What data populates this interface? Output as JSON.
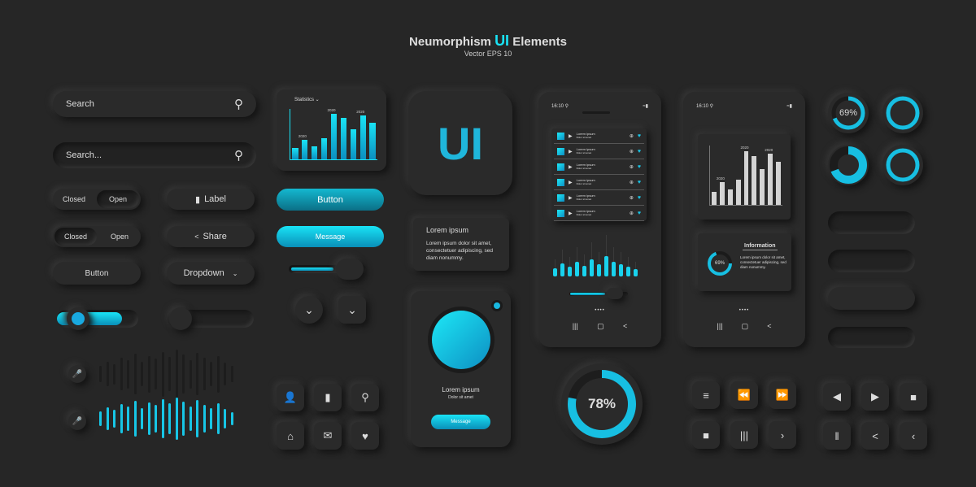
{
  "title": {
    "before": "Neumorphism ",
    "accent": "UI",
    "after": " Elements",
    "subtitle": "Vector EPS 10"
  },
  "colors": {
    "accent": "#19e3f5",
    "accent_dark": "#0a8fb8",
    "background": "#262626"
  },
  "search": [
    {
      "placeholder": "Search"
    },
    {
      "placeholder": "Search..."
    }
  ],
  "toggles": [
    {
      "off": "Closed",
      "on": "Open"
    },
    {
      "off": "Closed",
      "on": "Open"
    }
  ],
  "buttons": {
    "label": "Label",
    "share": "Share",
    "button": "Button",
    "dropdown": "Dropdown",
    "cyan_button": "Button",
    "cyan_message": "Message"
  },
  "sliders": {
    "on_level": 0.8,
    "off_level": 0,
    "small_slider_level": 0.55
  },
  "stat_chart": {
    "title": "Statistics",
    "values": [
      22,
      38,
      26,
      42,
      90,
      82,
      60,
      87,
      72
    ],
    "labels": {
      "1": "2020",
      "4": "2020",
      "7": "2020"
    }
  },
  "ui_card": {
    "text": "UI"
  },
  "lorem_card": {
    "title": "Lorem ipsum",
    "body": "Lorem ipsum dolor sit amet, consectetuer adipiscing, sed diam nonummy."
  },
  "player_card": {
    "title": "Lorem ipsum",
    "subtitle": "Dolor sit amet",
    "button": "Message"
  },
  "phone1": {
    "time": "16:10",
    "tracks": [
      {
        "title": "Lorem ipsum",
        "sub": "Dolor sit amet"
      },
      {
        "title": "Lorem ipsum",
        "sub": "Dolor sit amet"
      },
      {
        "title": "Lorem ipsum",
        "sub": "Dolor sit amet"
      },
      {
        "title": "Lorem ipsum",
        "sub": "Dolor sit amet"
      },
      {
        "title": "Lorem ipsum",
        "sub": "Dolor sit amet"
      },
      {
        "title": "Lorem ipsum",
        "sub": "Dolor sit amet"
      }
    ],
    "equalizer": [
      35,
      55,
      40,
      60,
      45,
      70,
      50,
      85,
      60,
      50,
      40,
      30
    ],
    "slider_level": 0.6
  },
  "phone2": {
    "time": "16:10",
    "chart_values": [
      22,
      38,
      26,
      42,
      90,
      82,
      60,
      87,
      72
    ],
    "labels": {
      "1": "2020",
      "4": "2020",
      "7": "2020"
    },
    "info_title": "Information",
    "info_body": "Lorem ipsum dolor sit amet, consectetuer adipiscing, sed diam nonummy.",
    "info_percent": "69%",
    "info_level": 0.69
  },
  "progress_big": {
    "label": "78%",
    "level": 0.78
  },
  "rings": [
    {
      "label": "69%",
      "level": 0.69
    },
    {
      "label": "",
      "level": 1
    },
    {
      "label": "",
      "level": 0.69
    },
    {
      "label": "",
      "level": 1
    }
  ],
  "waves": {
    "gray": [
      20,
      30,
      25,
      40,
      35,
      50,
      30,
      45,
      38,
      55,
      42,
      60,
      48,
      35,
      52,
      40,
      30,
      45,
      28,
      20
    ],
    "cyan": [
      18,
      28,
      22,
      36,
      30,
      44,
      26,
      40,
      34,
      48,
      38,
      52,
      42,
      30,
      46,
      34,
      26,
      38,
      24,
      16
    ]
  },
  "icons": {
    "grid": [
      "user-icon",
      "bookmark-icon",
      "search-icon",
      "home-icon",
      "mail-icon",
      "heart-icon"
    ],
    "media": [
      "menu-icon",
      "rewind-icon",
      "fast-forward-icon",
      "stop-icon",
      "bars-icon",
      "next-icon"
    ],
    "media2": [
      "prev-icon",
      "play-icon",
      "stop-icon",
      "pause-icon",
      "share-icon",
      "back-icon"
    ]
  }
}
